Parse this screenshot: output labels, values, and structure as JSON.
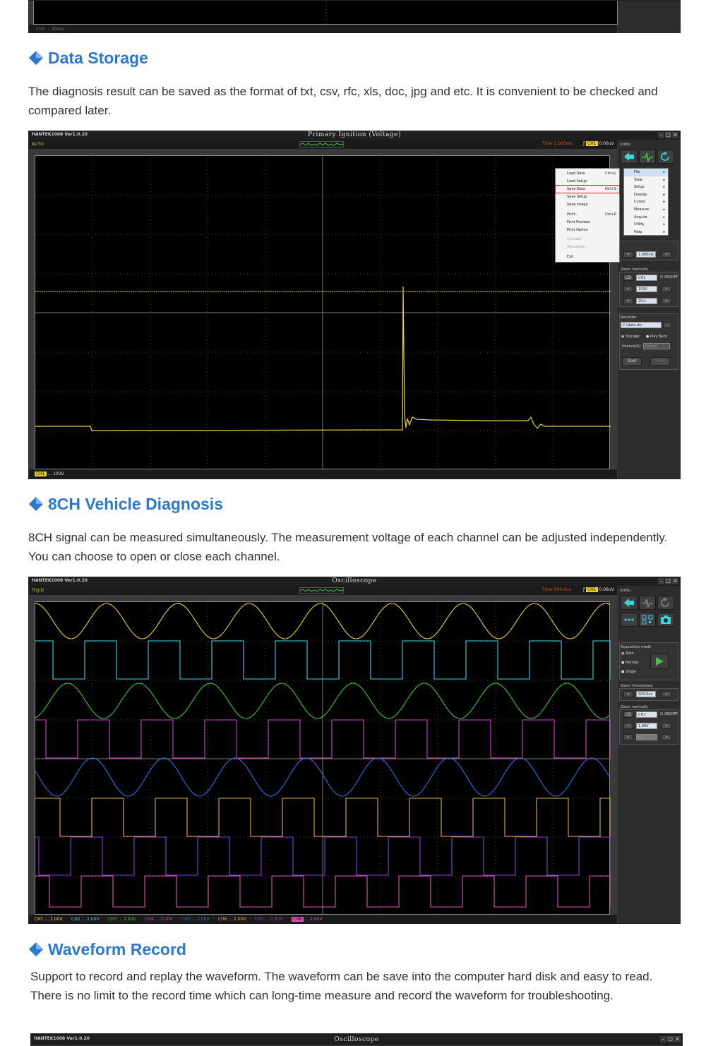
{
  "sections": [
    {
      "title": "Data Storage",
      "paragraph": "The diagnosis result can be saved as the format of txt, csv, rfc, xls, doc, jpg and etc. It is convenient to be checked and compared later."
    },
    {
      "title": "8CH Vehicle Diagnosis",
      "paragraph": "8CH signal can be measured simultaneously. The measurement voltage of each channel can be adjusted independently. You can choose to open or close each channel."
    },
    {
      "title": "Waveform Record",
      "paragraph": "Support to record and replay the waveform. The waveform can be save into the computer hard disk and easy to read. There is no limit to the record time which can long-time measure and record the waveform for troubleshooting."
    }
  ],
  "top_scope": {
    "bottom_label": "CH1 ... 10mV"
  },
  "scope1": {
    "app_name": "HANTEK1008 Ver1.0.20",
    "title": "Primary Ignition (Voltage)",
    "mode": "AUTO",
    "time": "Time 1.000ms",
    "channel": "CH1",
    "voltage": "0.00uV",
    "bottom_label": "CH1 ... 100V",
    "utility_label": "Utility",
    "file_menu": [
      {
        "label": "Load Data",
        "shortcut": "Ctrl+L",
        "disabled": false
      },
      {
        "label": "Load Setup",
        "shortcut": "",
        "disabled": false
      },
      {
        "label": "Save Data",
        "shortcut": "Ctrl+S",
        "disabled": false,
        "highlight": true
      },
      {
        "label": "Save Setup",
        "shortcut": "",
        "disabled": false
      },
      {
        "label": "Save Image",
        "shortcut": "",
        "disabled": false
      },
      {
        "label": "Print...",
        "shortcut": "Ctrl+P",
        "disabled": false
      },
      {
        "label": "Print Preview",
        "shortcut": "",
        "disabled": false
      },
      {
        "label": "Print Option",
        "shortcut": "",
        "disabled": false
      },
      {
        "label": "Connect",
        "shortcut": "",
        "disabled": true
      },
      {
        "label": "Advanced...",
        "shortcut": "",
        "disabled": true
      },
      {
        "label": "Exit",
        "shortcut": "",
        "disabled": false
      }
    ],
    "main_menu": [
      "File",
      "View",
      "Setup",
      "Display",
      "Cursor",
      "Measure",
      "Acquire",
      "Utility",
      "Help"
    ],
    "zoom_horizontal_value": "1.000ms",
    "zoom_vertically_label": "Zoom vertically",
    "ch_select": "CH1",
    "onoff_label": "ON/OFF",
    "volt_div": "100V",
    "probe": "20:1",
    "recorder_label": "Recorder",
    "recorder_path": "C:\\data.drc",
    "browse": "...",
    "storage_label": "Storage",
    "playback_label": "Play Back",
    "interval_label": "Interval(S)",
    "interval_value": "Fastest",
    "start_label": "Start",
    "stop_label": "Stop"
  },
  "scope2": {
    "app_name": "HANTEK1008 Ver1.0.20",
    "title": "Oscilloscope",
    "mode": "Trig'D",
    "time": "Time 500.0us",
    "channel": "CH1",
    "voltage": "0.00uV",
    "utility_label": "Utility",
    "acquisition_label": "Acquisition mode",
    "acq_modes": [
      "Auto",
      "Normal",
      "Single"
    ],
    "zoom_horizontal_label": "Zoom Horizontally",
    "zoom_horizontal_value": "500.0us",
    "zoom_vertically_label": "Zoom vertically",
    "ch_select": "CH1",
    "onoff_label": "ON/OFF",
    "volt_div": "1.00V",
    "probe": "x1",
    "channels": [
      {
        "name": "CH1",
        "scale": "2.00V",
        "color": "#e7d43b"
      },
      {
        "name": "CH2",
        "scale": "2.00V",
        "color": "#3bd3e0"
      },
      {
        "name": "CH3",
        "scale": "2.00V",
        "color": "#3fc73a"
      },
      {
        "name": "CH4",
        "scale": "2.00V",
        "color": "#d63fd0"
      },
      {
        "name": "CH5",
        "scale": "2.00V",
        "color": "#2f6fe0"
      },
      {
        "name": "CH6",
        "scale": "2.00V",
        "color": "#e0b33a"
      },
      {
        "name": "CH7",
        "scale": "2.00V",
        "color": "#8d3be0"
      },
      {
        "name": "CH8",
        "scale": "2.00V",
        "color": "#e055b8"
      }
    ]
  },
  "scope3": {
    "app_name": "HANTEK1008 Ver1.0.20",
    "title": "Oscilloscope"
  },
  "colors": {
    "heading": "#2d78cf",
    "ch1_yellow": "#e7d43b"
  }
}
